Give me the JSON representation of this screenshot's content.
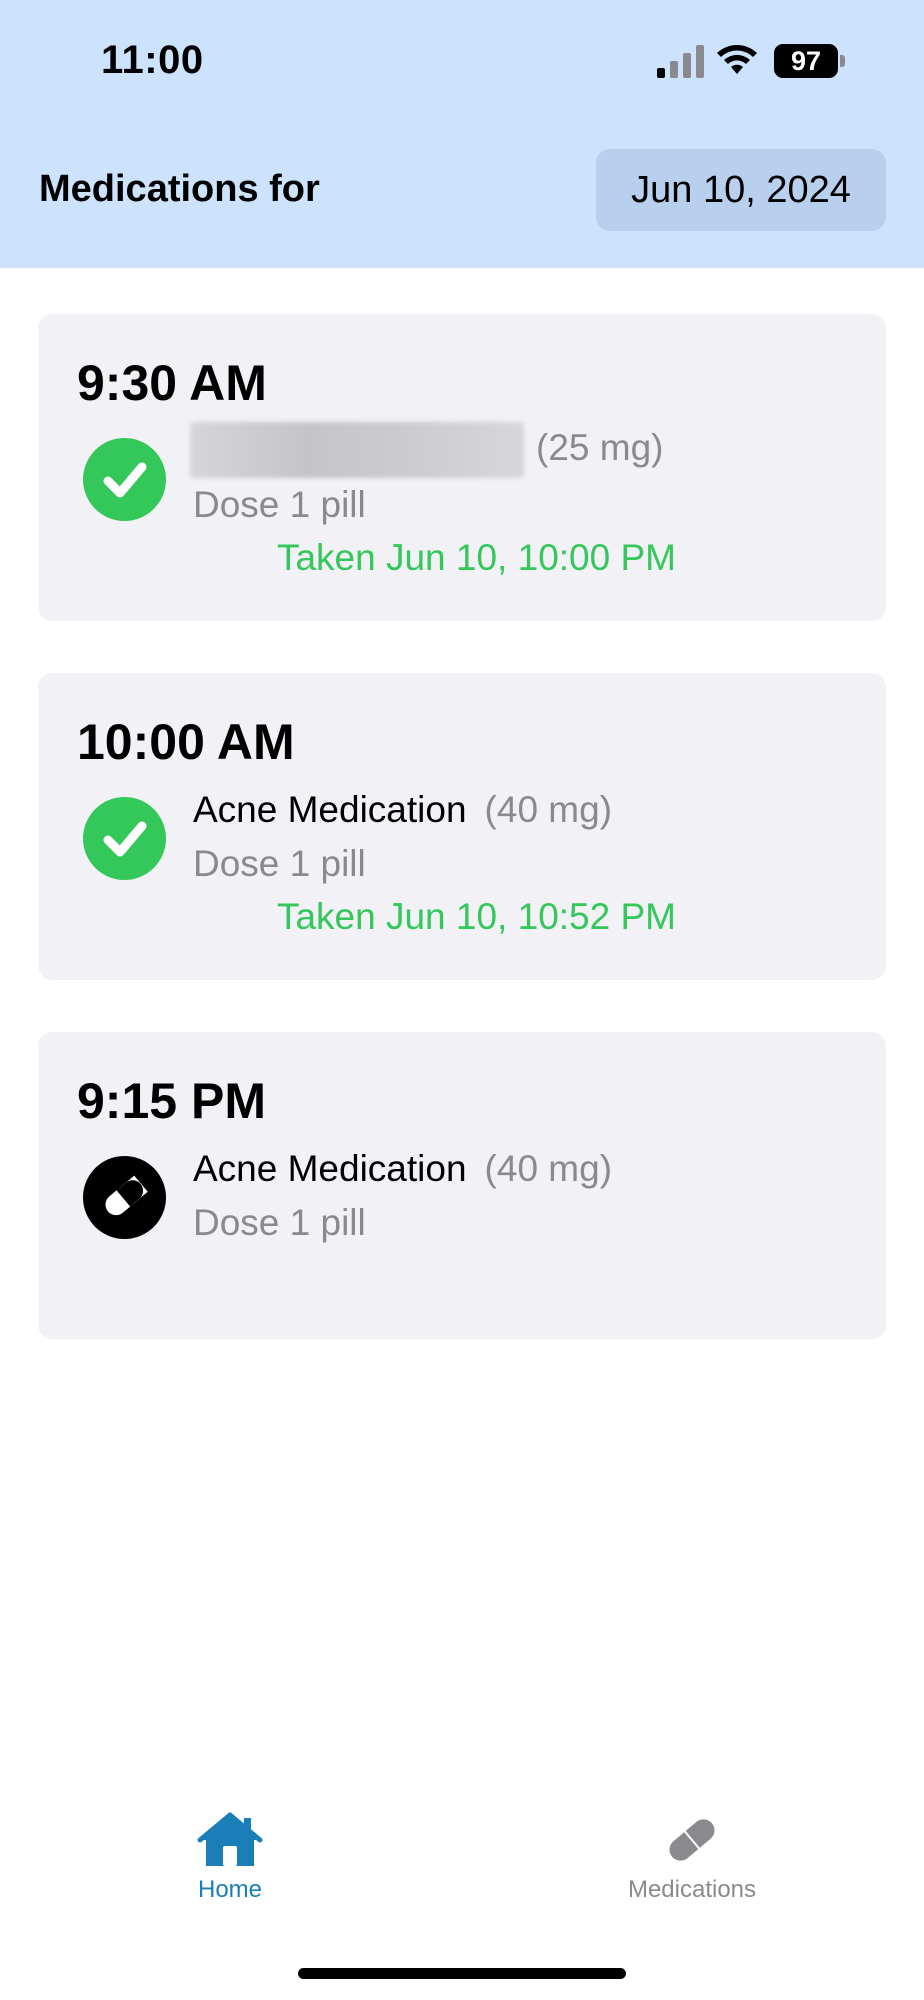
{
  "status_bar": {
    "time": "11:00",
    "battery": "97"
  },
  "header": {
    "title": "Medications for",
    "date": "Jun 10, 2024"
  },
  "doses": [
    {
      "time": "9:30 AM",
      "name": "",
      "name_redacted": true,
      "strength": "(25 mg)",
      "dose": "Dose 1 pill",
      "status": "taken",
      "taken_text": "Taken Jun 10, 10:00 PM"
    },
    {
      "time": "10:00 AM",
      "name": "Acne Medication",
      "strength": "(40 mg)",
      "dose": "Dose 1 pill",
      "status": "taken",
      "taken_text": "Taken Jun 10, 10:52 PM"
    },
    {
      "time": "9:15 PM",
      "name": "Acne Medication",
      "strength": "(40 mg)",
      "dose": "Dose 1 pill",
      "status": "pending"
    }
  ],
  "tab_bar": {
    "tabs": [
      {
        "label": "Home",
        "icon": "house-icon",
        "active": true
      },
      {
        "label": "Medications",
        "icon": "pill-icon",
        "active": false
      }
    ]
  },
  "colors": {
    "header_bg": "#cce2fd",
    "date_button_bg": "#b8d0ee",
    "card_bg": "#f1f1f6",
    "taken_green": "#34c759",
    "secondary_text": "#8a8a8e",
    "active_tab": "#1a7fb8"
  }
}
